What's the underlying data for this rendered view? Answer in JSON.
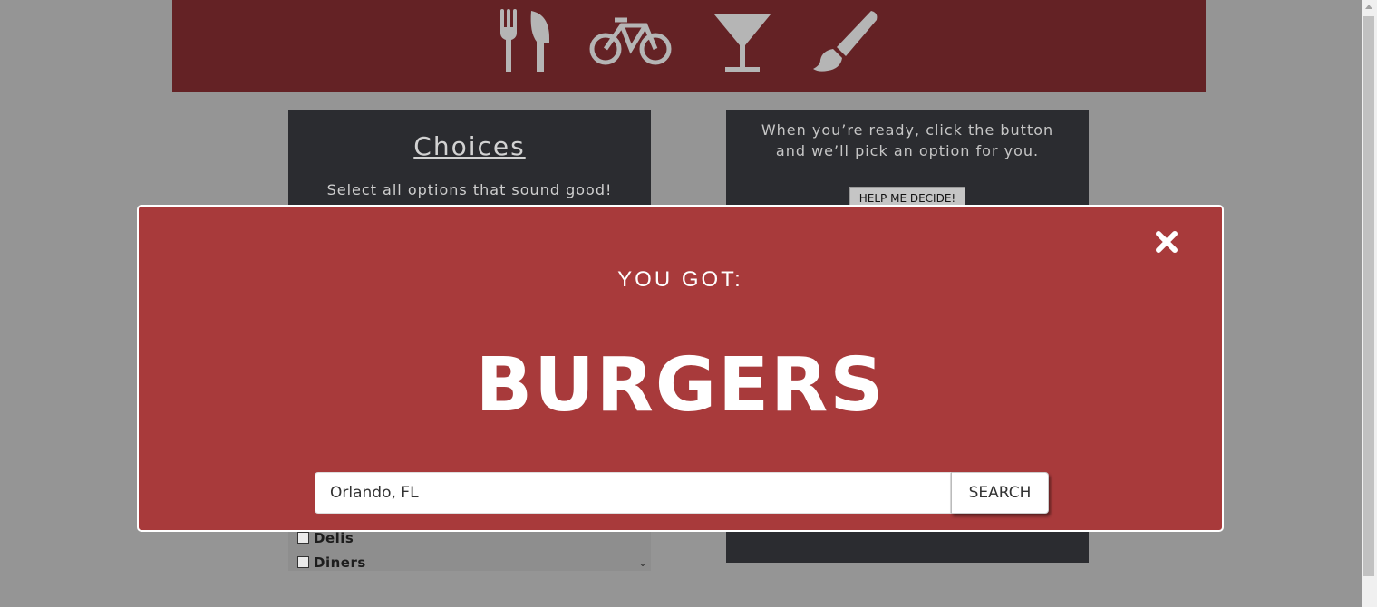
{
  "header": {
    "icons": [
      "fork-knife-icon",
      "bicycle-icon",
      "cocktail-icon",
      "paintbrush-icon"
    ],
    "colors": {
      "band": "#642225",
      "icon": "#b5b5b5"
    }
  },
  "choices": {
    "title": "Choices",
    "subtitle": "Select all options that sound good!",
    "options": [
      "Delis",
      "Diners"
    ]
  },
  "decide": {
    "text": "When you’re ready, click the button and we’ll pick an option for you.",
    "button_label": "HELP ME DECIDE!"
  },
  "modal": {
    "heading": "YOU GOT:",
    "result": "BURGERS",
    "search": {
      "value": "Orlando, FL",
      "button_label": "SEARCH"
    },
    "close_icon": "close-icon",
    "colors": {
      "background": "#a83a3b",
      "text": "#ffffff"
    }
  }
}
